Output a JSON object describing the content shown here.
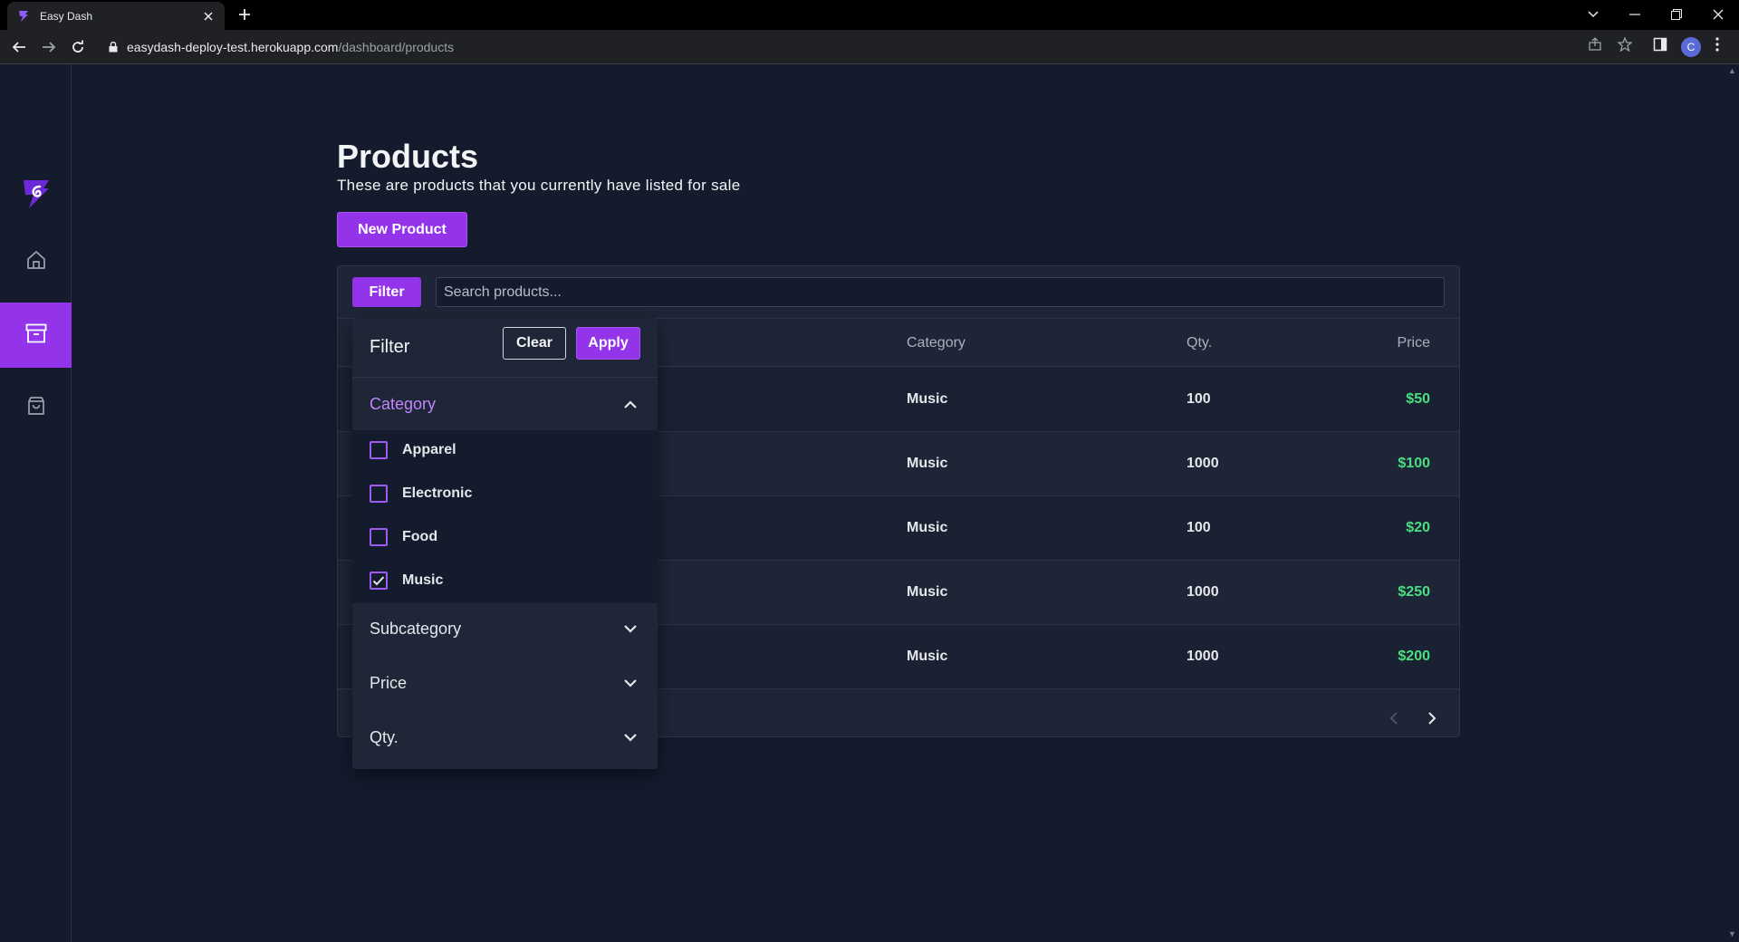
{
  "browser": {
    "tab_title": "Easy Dash",
    "url_host": "easydash-deploy-test.herokuapp.com",
    "url_path": "/dashboard/products",
    "profile_initial": "C"
  },
  "sidebar": {
    "items": [
      {
        "name": "home",
        "icon": "home-icon",
        "active": false
      },
      {
        "name": "products",
        "icon": "archive-box-icon",
        "active": true
      },
      {
        "name": "orders",
        "icon": "shopping-bag-icon",
        "active": false
      }
    ]
  },
  "page": {
    "title": "Products",
    "subtitle": "These are products that you currently have listed for sale",
    "new_product_label": "New Product"
  },
  "toolbar": {
    "filter_label": "Filter",
    "search_placeholder": "Search products..."
  },
  "table": {
    "columns": {
      "category": "Category",
      "qty": "Qty.",
      "price": "Price"
    },
    "rows": [
      {
        "category": "Music",
        "qty": "100",
        "price": "$50"
      },
      {
        "category": "Music",
        "qty": "1000",
        "price": "$100"
      },
      {
        "category": "Music",
        "qty": "100",
        "price": "$20"
      },
      {
        "category": "Music",
        "qty": "1000",
        "price": "$250"
      },
      {
        "category": "Music",
        "qty": "1000",
        "price": "$200"
      }
    ]
  },
  "filter_panel": {
    "title": "Filter",
    "clear_label": "Clear",
    "apply_label": "Apply",
    "sections": [
      {
        "label": "Category",
        "expanded": true
      },
      {
        "label": "Subcategory",
        "expanded": false
      },
      {
        "label": "Price",
        "expanded": false
      },
      {
        "label": "Qty.",
        "expanded": false
      }
    ],
    "category_options": [
      {
        "label": "Apparel",
        "checked": false
      },
      {
        "label": "Electronic",
        "checked": false
      },
      {
        "label": "Food",
        "checked": false
      },
      {
        "label": "Music",
        "checked": true
      }
    ]
  },
  "colors": {
    "accent": "#9333ea",
    "background": "#141b2d",
    "price_green": "#4ade80"
  }
}
